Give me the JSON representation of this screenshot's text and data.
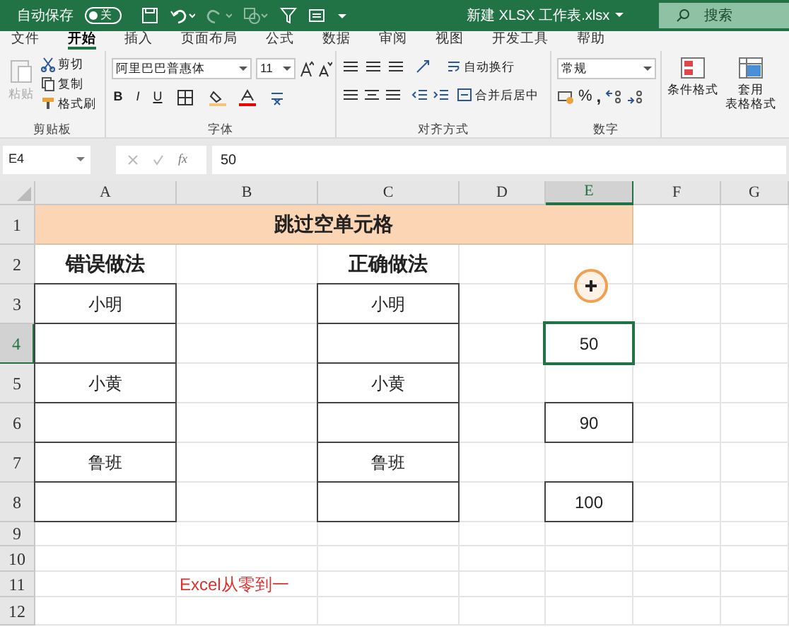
{
  "title_bar": {
    "autosave_label": "自动保存",
    "autosave_on": false,
    "autosave_state": "关",
    "title": "新建 XLSX 工作表.xlsx",
    "search_placeholder": "搜索"
  },
  "menu_tabs": [
    {
      "label": "文件",
      "selected": false
    },
    {
      "label": "开始",
      "selected": true
    },
    {
      "label": "插入",
      "selected": false
    },
    {
      "label": "页面布局",
      "selected": false
    },
    {
      "label": "公式",
      "selected": false
    },
    {
      "label": "数据",
      "selected": false
    },
    {
      "label": "审阅",
      "selected": false
    },
    {
      "label": "视图",
      "selected": false
    },
    {
      "label": "开发工具",
      "selected": false
    },
    {
      "label": "帮助",
      "selected": false
    }
  ],
  "ribbon": {
    "clipboard": {
      "label": "剪贴板",
      "paste": {
        "label": "粘贴",
        "disabled": true
      },
      "cut": "剪切",
      "copy": "复制",
      "format_painter": "格式刷"
    },
    "font": {
      "label": "字体",
      "font_name": "阿里巴巴普惠体",
      "font_size": "11",
      "format_buttons": [
        "B",
        "I",
        "U"
      ]
    },
    "alignment": {
      "label": "对齐方式",
      "wrap_text": "自动换行",
      "merge_center": "合并后居中"
    },
    "number": {
      "label": "数字",
      "format": "常规",
      "percent": "%",
      "comma": ","
    },
    "styles": {
      "conditional_format": "条件格式",
      "table_format_line1": "套用",
      "table_format_line2": "表格格式"
    }
  },
  "formula_bar": {
    "name_box": "E4",
    "function_label": "fx",
    "formula": "50"
  },
  "sheet": {
    "columns": [
      {
        "label": "A",
        "selected": false
      },
      {
        "label": "B",
        "selected": false
      },
      {
        "label": "C",
        "selected": false
      },
      {
        "label": "D",
        "selected": false
      },
      {
        "label": "E",
        "selected": true
      },
      {
        "label": "F",
        "selected": false
      },
      {
        "label": "G",
        "selected": false
      }
    ],
    "rows": [
      {
        "label": "1",
        "selected": false,
        "title": "跳过空单元格",
        "cells": []
      },
      {
        "label": "2",
        "selected": false,
        "cells": [
          {
            "text": "错误做法",
            "bold": true,
            "boxed": false
          },
          {
            "text": "",
            "boxed": false
          },
          {
            "text": "正确做法",
            "bold": true,
            "boxed": false
          },
          {
            "text": "",
            "boxed": false
          },
          {
            "text": "",
            "boxed": false
          },
          {
            "text": "",
            "boxed": false
          },
          {
            "text": "",
            "boxed": false
          }
        ]
      },
      {
        "label": "3",
        "selected": false,
        "cells": [
          {
            "text": "小明",
            "boxed": true
          },
          {
            "text": "",
            "boxed": false
          },
          {
            "text": "小明",
            "boxed": true
          },
          {
            "text": "",
            "boxed": false
          },
          {
            "text": "",
            "boxed": false
          },
          {
            "text": "",
            "boxed": false
          },
          {
            "text": "",
            "boxed": false
          }
        ]
      },
      {
        "label": "4",
        "selected": true,
        "cells": [
          {
            "text": "",
            "boxed": true
          },
          {
            "text": "",
            "boxed": false
          },
          {
            "text": "",
            "boxed": true
          },
          {
            "text": "",
            "boxed": false
          },
          {
            "text": "50",
            "boxed": true,
            "active": true
          },
          {
            "text": "",
            "boxed": false
          },
          {
            "text": "",
            "boxed": false
          }
        ]
      },
      {
        "label": "5",
        "selected": false,
        "cells": [
          {
            "text": "小黄",
            "boxed": true
          },
          {
            "text": "",
            "boxed": false
          },
          {
            "text": "小黄",
            "boxed": true
          },
          {
            "text": "",
            "boxed": false
          },
          {
            "text": "",
            "boxed": false
          },
          {
            "text": "",
            "boxed": false
          },
          {
            "text": "",
            "boxed": false
          }
        ]
      },
      {
        "label": "6",
        "selected": false,
        "cells": [
          {
            "text": "",
            "boxed": true
          },
          {
            "text": "",
            "boxed": false
          },
          {
            "text": "",
            "boxed": true
          },
          {
            "text": "",
            "boxed": false
          },
          {
            "text": "90",
            "boxed": true
          },
          {
            "text": "",
            "boxed": false
          },
          {
            "text": "",
            "boxed": false
          }
        ]
      },
      {
        "label": "7",
        "selected": false,
        "cells": [
          {
            "text": "鲁班",
            "boxed": true
          },
          {
            "text": "",
            "boxed": false
          },
          {
            "text": "鲁班",
            "boxed": true
          },
          {
            "text": "",
            "boxed": false
          },
          {
            "text": "",
            "boxed": false
          },
          {
            "text": "",
            "boxed": false
          },
          {
            "text": "",
            "boxed": false
          }
        ]
      },
      {
        "label": "8",
        "selected": false,
        "cells": [
          {
            "text": "",
            "boxed": true
          },
          {
            "text": "",
            "boxed": false
          },
          {
            "text": "",
            "boxed": true
          },
          {
            "text": "",
            "boxed": false
          },
          {
            "text": "100",
            "boxed": true
          },
          {
            "text": "",
            "boxed": false
          },
          {
            "text": "",
            "boxed": false
          }
        ]
      },
      {
        "label": "9",
        "selected": false,
        "cells": []
      },
      {
        "label": "10",
        "selected": false,
        "cells": []
      },
      {
        "label": "11",
        "selected": false,
        "cells": [
          {
            "text": "",
            "boxed": false
          },
          {
            "text": "Excel从零到一",
            "boxed": false,
            "color": "#e03030"
          }
        ]
      },
      {
        "label": "12",
        "selected": false,
        "cells": []
      }
    ]
  }
}
